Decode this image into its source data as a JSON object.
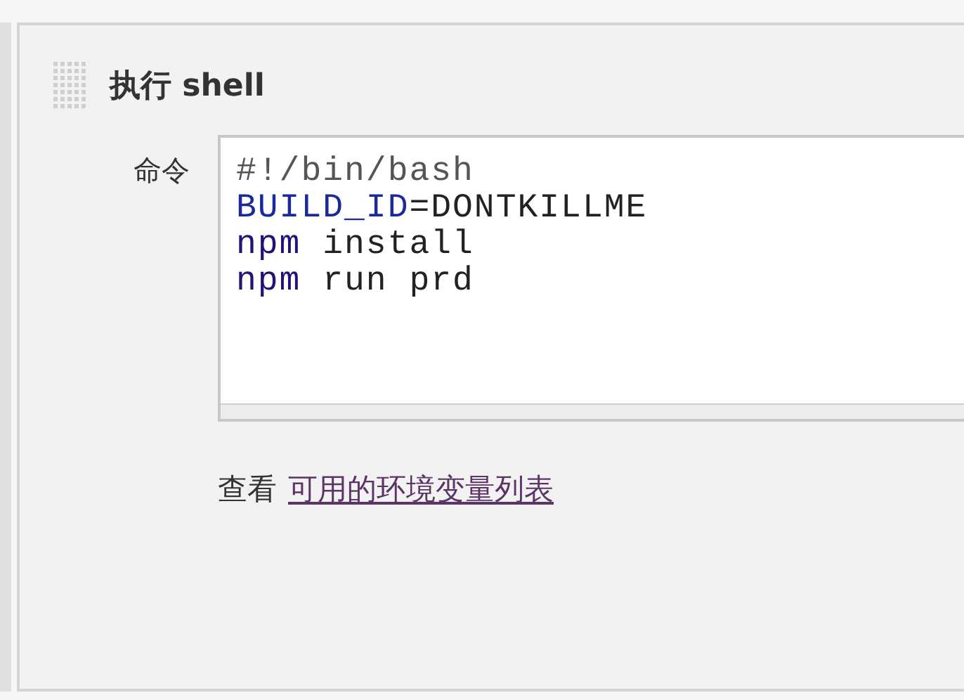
{
  "section": {
    "title": "执行 shell"
  },
  "command": {
    "label": "命令",
    "lines": [
      {
        "tokens": [
          {
            "text": "#!/bin/bash",
            "kind": "comment"
          }
        ]
      },
      {
        "tokens": [
          {
            "text": "BUILD_ID",
            "kind": "variable"
          },
          {
            "text": "=DONTKILLME",
            "kind": "plain"
          }
        ]
      },
      {
        "tokens": [
          {
            "text": "npm",
            "kind": "keyword"
          },
          {
            "text": " install",
            "kind": "plain"
          }
        ]
      },
      {
        "tokens": [
          {
            "text": "npm",
            "kind": "keyword"
          },
          {
            "text": " run prd",
            "kind": "plain"
          }
        ]
      }
    ]
  },
  "help": {
    "prefix": "查看",
    "link": "可用的环境变量列表"
  }
}
